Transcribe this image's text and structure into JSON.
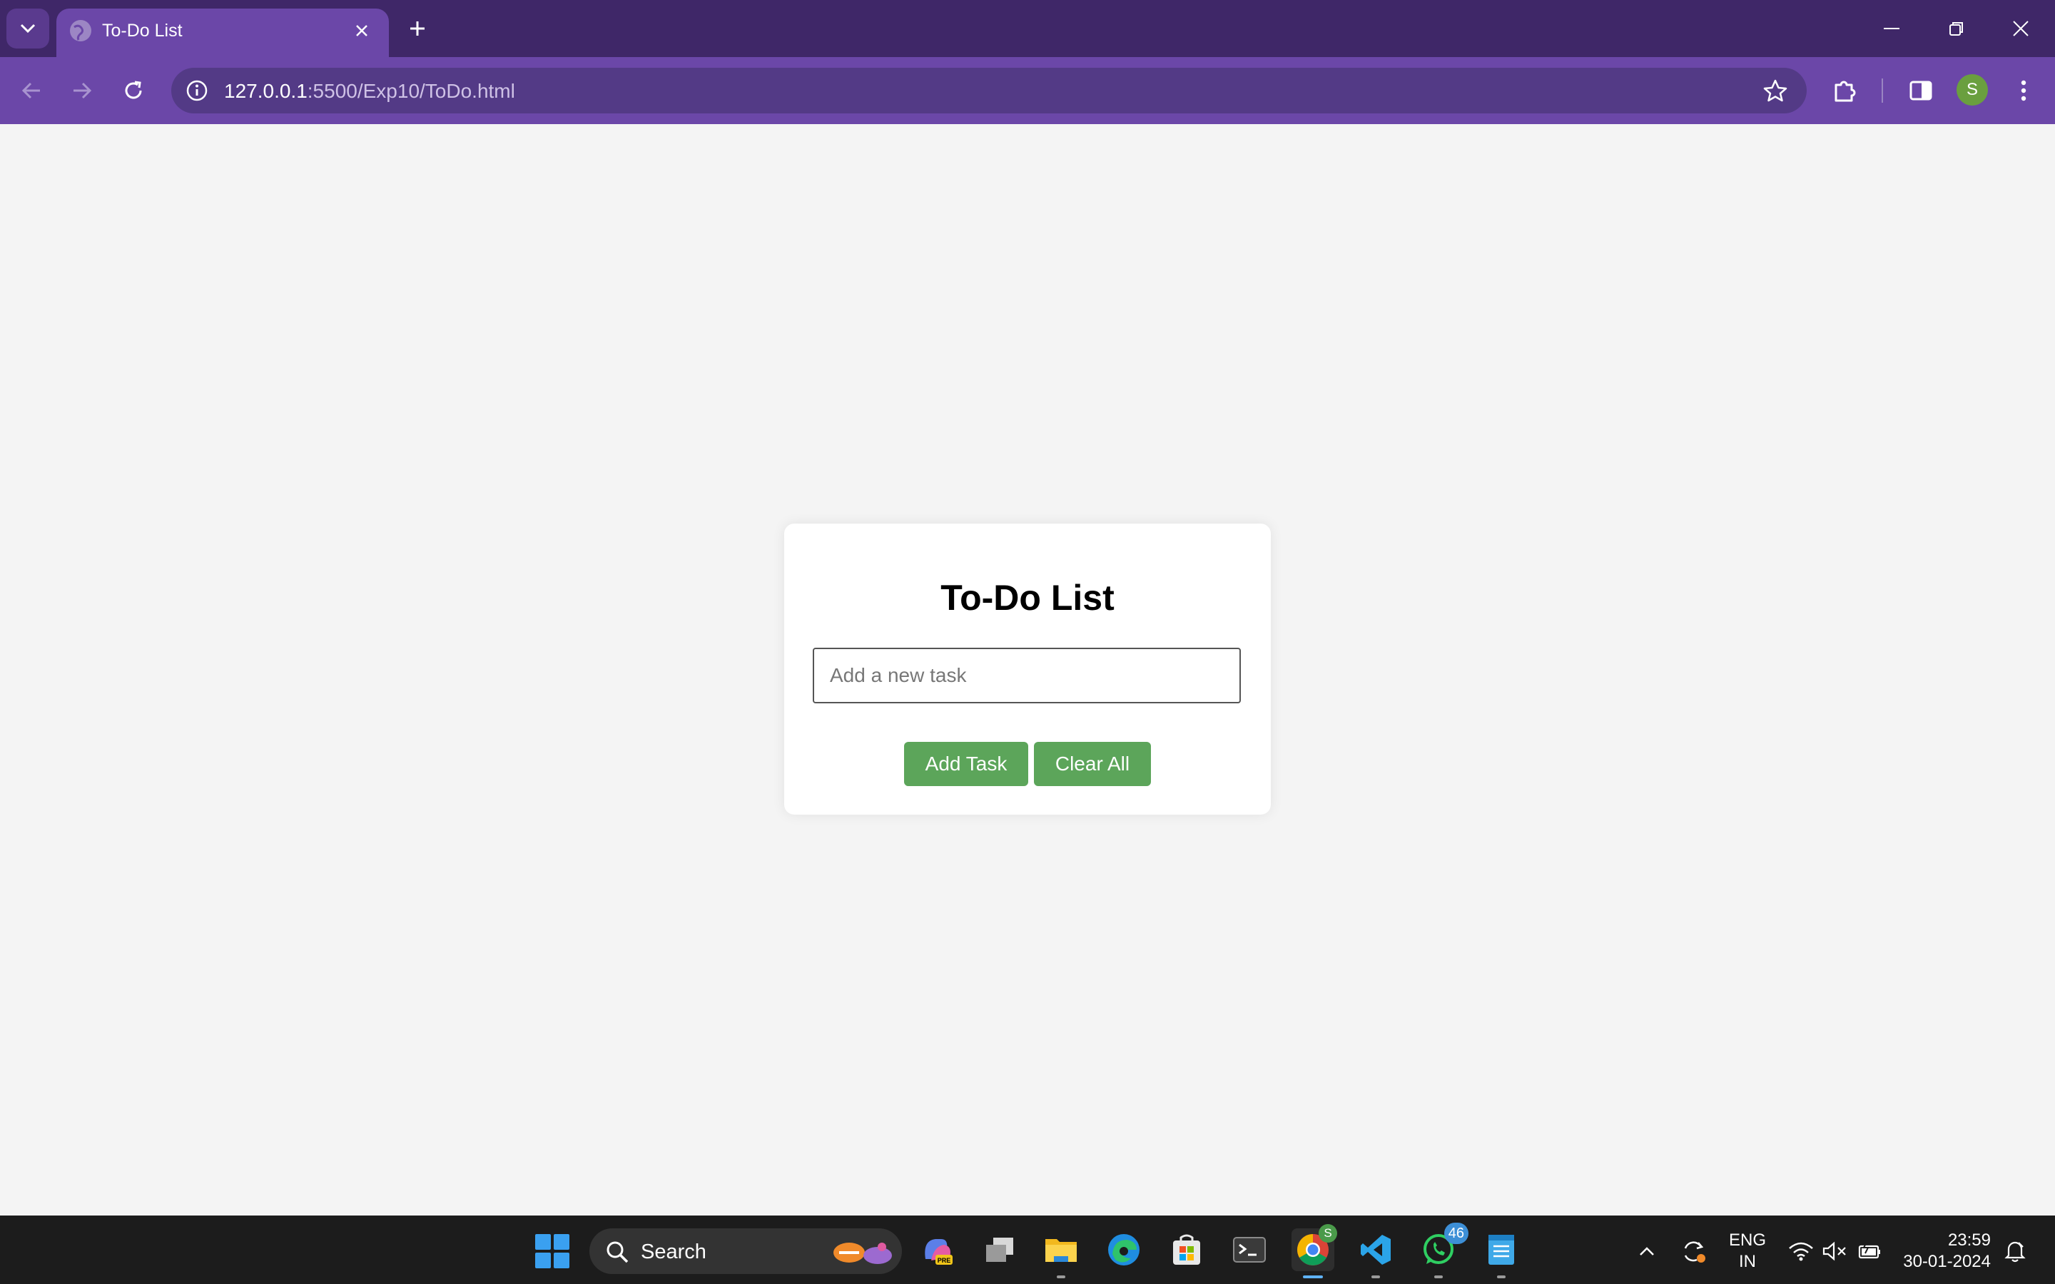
{
  "browser": {
    "tab_title": "To-Do List",
    "url_host": "127.0.0.1",
    "url_rest": ":5500/Exp10/ToDo.html",
    "profile_initial": "S"
  },
  "page": {
    "title": "To-Do List",
    "input_placeholder": "Add a new task",
    "input_value": "",
    "add_button": "Add Task",
    "clear_button": "Clear All"
  },
  "taskbar": {
    "search_label": "Search",
    "whatsapp_badge": "46",
    "chrome_profile_badge": "S",
    "lang_line1": "ENG",
    "lang_line2": "IN",
    "time": "23:59",
    "date": "30-01-2024",
    "pinned_apps": [
      "copilot-icon",
      "task-view-icon",
      "file-explorer-icon",
      "edge-icon",
      "store-icon",
      "terminal-icon",
      "chrome-icon",
      "vscode-icon",
      "whatsapp-icon",
      "notepad-icon"
    ]
  },
  "colors": {
    "titlebar": "#3f2768",
    "toolbar": "#6b47a8",
    "page_bg": "#f4f4f4",
    "button_green": "#5ca55a",
    "taskbar": "#1c1c1c"
  }
}
